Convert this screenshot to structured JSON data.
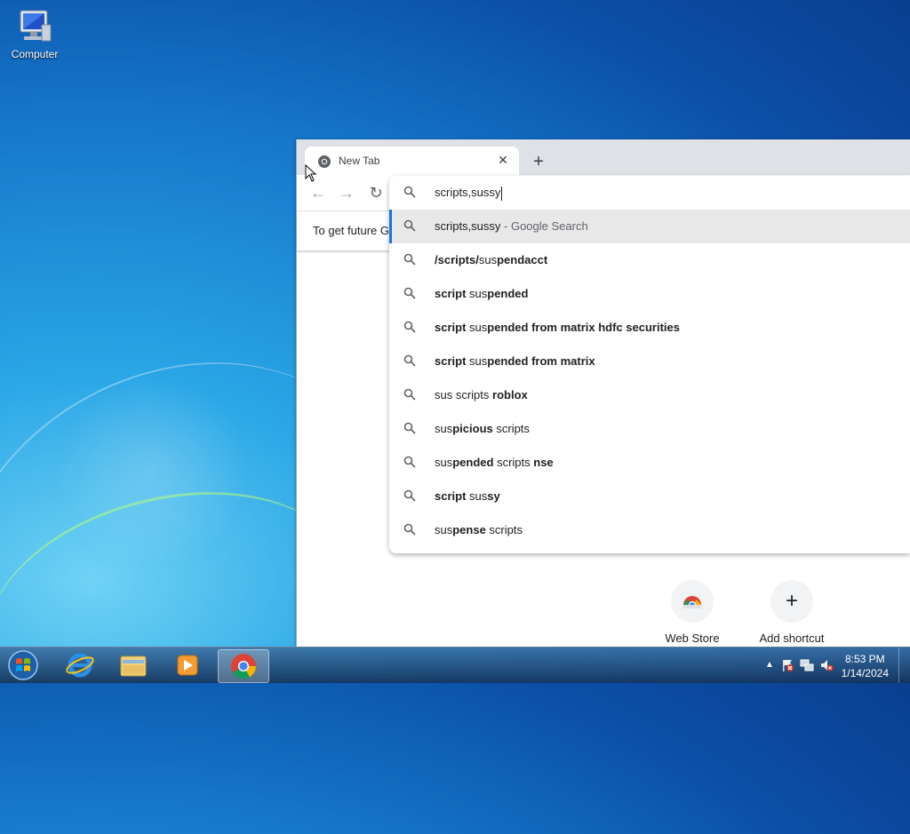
{
  "desktop": {
    "icons": [
      {
        "label": "Computer",
        "icon": "computer-icon"
      }
    ]
  },
  "browser": {
    "tab": {
      "title": "New Tab",
      "close_glyph": "✕"
    },
    "new_tab_glyph": "+",
    "toolbar": {
      "back_glyph": "←",
      "forward_glyph": "→",
      "reload_glyph": "↻"
    },
    "infobar_text": "To get future G",
    "shortcuts": [
      {
        "label": "Web Store",
        "icon": "chrome-web-store-icon"
      },
      {
        "label": "Add shortcut",
        "icon": "plus-icon",
        "glyph": "+"
      }
    ]
  },
  "omnibox": {
    "value": "scripts,sussy",
    "suggestions": [
      {
        "parts": [
          {
            "t": "scripts,sussy",
            "b": false
          },
          {
            "t": " - Google Search",
            "dim": true
          }
        ]
      },
      {
        "parts": [
          {
            "t": "/scripts/",
            "b": true
          },
          {
            "t": "sus",
            "b": false
          },
          {
            "t": "pendacct",
            "b": true
          }
        ]
      },
      {
        "parts": [
          {
            "t": "script ",
            "b": true
          },
          {
            "t": "sus",
            "b": false
          },
          {
            "t": "pended",
            "b": true
          }
        ]
      },
      {
        "parts": [
          {
            "t": "script ",
            "b": true
          },
          {
            "t": "sus",
            "b": false
          },
          {
            "t": "pended from matrix hdfc securities",
            "b": true
          }
        ]
      },
      {
        "parts": [
          {
            "t": "script ",
            "b": true
          },
          {
            "t": "sus",
            "b": false
          },
          {
            "t": "pended from matrix",
            "b": true
          }
        ]
      },
      {
        "parts": [
          {
            "t": "sus scripts ",
            "b": false
          },
          {
            "t": "roblox",
            "b": true
          }
        ]
      },
      {
        "parts": [
          {
            "t": "sus",
            "b": false
          },
          {
            "t": "picious",
            "b": true
          },
          {
            "t": " scripts",
            "b": false
          }
        ]
      },
      {
        "parts": [
          {
            "t": "sus",
            "b": false
          },
          {
            "t": "pended",
            "b": true
          },
          {
            "t": " scripts ",
            "b": false
          },
          {
            "t": "nse",
            "b": true
          }
        ]
      },
      {
        "parts": [
          {
            "t": "script ",
            "b": true
          },
          {
            "t": "sus",
            "b": false
          },
          {
            "t": "sy",
            "b": true
          }
        ]
      },
      {
        "parts": [
          {
            "t": "sus",
            "b": false
          },
          {
            "t": "pense",
            "b": true
          },
          {
            "t": " scripts",
            "b": false
          }
        ]
      }
    ]
  },
  "taskbar": {
    "apps": [
      "internet-explorer-icon",
      "file-explorer-icon",
      "media-player-icon",
      "chrome-icon"
    ],
    "tray": {
      "time": "8:53 PM",
      "date": "1/14/2024"
    }
  },
  "colors": {
    "accent": "#1a73e8",
    "selected_row": "#e8e8e9",
    "tabstrip": "#dee1e6"
  }
}
